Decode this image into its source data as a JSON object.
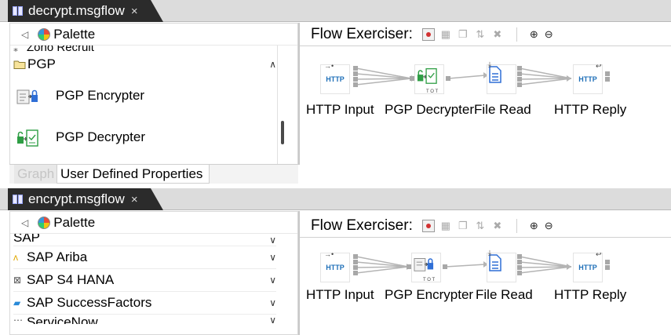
{
  "editors": [
    {
      "tab": {
        "title": "decrypt.msgflow",
        "close": "×"
      },
      "palette": {
        "title": "Palette",
        "back_glyph": "◁",
        "items": [
          {
            "label": "Zoho Recruit",
            "kind": "drawer-partial"
          },
          {
            "label": "PGP",
            "kind": "drawer",
            "expanded": true
          },
          {
            "label": "PGP Encrypter",
            "kind": "node",
            "icon": "pgp-encrypter-icon"
          },
          {
            "label": "PGP Decrypter",
            "kind": "node",
            "icon": "pgp-decrypter-icon"
          }
        ],
        "scroll_position": 0.55
      },
      "properties_tabs": [
        "Graph",
        "User Defined Properties"
      ],
      "flow_exerciser_label": "Flow Exerciser:",
      "nodes": [
        {
          "label": "HTTP Input",
          "icon_text": "HTTP"
        },
        {
          "label": "PGP Decrypter",
          "icon_text": ""
        },
        {
          "label": "File Read",
          "icon_text": ""
        },
        {
          "label": "HTTP Reply",
          "icon_text": "HTTP"
        }
      ]
    },
    {
      "tab": {
        "title": "encrypt.msgflow",
        "close": "×"
      },
      "palette": {
        "title": "Palette",
        "back_glyph": "◁",
        "items": [
          {
            "label": "SAP",
            "kind": "drawer-partial"
          },
          {
            "label": "SAP Ariba",
            "kind": "drawer"
          },
          {
            "label": "SAP S4 HANA",
            "kind": "drawer"
          },
          {
            "label": "SAP SuccessFactors",
            "kind": "drawer"
          },
          {
            "label": "ServiceNow",
            "kind": "drawer-partial"
          }
        ]
      },
      "flow_exerciser_label": "Flow Exerciser:",
      "nodes": [
        {
          "label": "HTTP Input",
          "icon_text": "HTTP"
        },
        {
          "label": "PGP Encrypter",
          "icon_text": ""
        },
        {
          "label": "File Read",
          "icon_text": ""
        },
        {
          "label": "HTTP Reply",
          "icon_text": "HTTP"
        }
      ]
    }
  ],
  "icons": {
    "drawer_collapsed": "∨",
    "drawer_expanded": "∧",
    "zoom_in": "⊕",
    "zoom_out": "⊖"
  },
  "colors": {
    "tab_bg": "#2b2b2b",
    "http_text": "#1e6fb8",
    "pgp_green": "#2e9e44",
    "pgp_blue": "#2f6fd6",
    "record_red": "#d23232"
  }
}
